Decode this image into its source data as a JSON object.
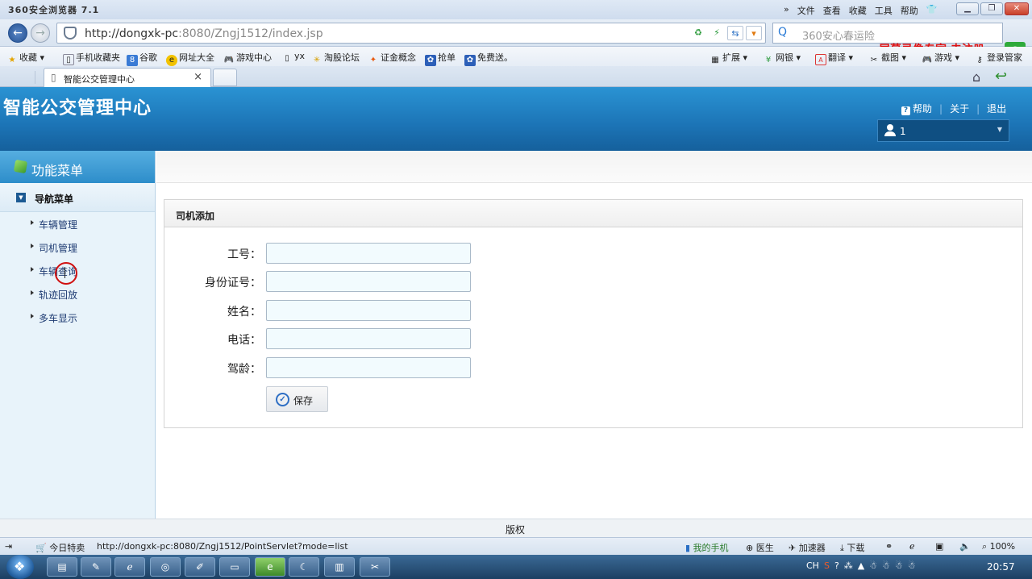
{
  "browser": {
    "title": "360安全浏览器 7.1",
    "menus": [
      "»",
      "文件",
      "查看",
      "收藏",
      "工具",
      "帮助"
    ],
    "url_host": "http://dongxk-pc",
    "url_path": ":8080/Zngj1512/index.jsp",
    "search_placeholder": "360安心春运险",
    "watermark": "屏幕录像专家  未注册",
    "bookmarks": [
      "收藏",
      "手机收藏夹",
      "谷歌",
      "网址大全",
      "游戏中心",
      "yx",
      "淘股论坛",
      "证金概念",
      "抢单",
      "免费送。"
    ],
    "toolbar_right": [
      "扩展",
      "网银",
      "翻译",
      "截图",
      "游戏",
      "登录管家"
    ],
    "tab_title": "智能公交管理中心",
    "tab_close": "×"
  },
  "app": {
    "title": "智能公交管理中心",
    "links": {
      "help": "帮助",
      "about": "关于",
      "logout": "退出"
    },
    "user": "1"
  },
  "sidebar": {
    "header": "功能菜单",
    "group": "导航菜单",
    "items": [
      "车辆管理",
      "司机管理",
      "车辆查询",
      "轨迹回放",
      "多车显示"
    ]
  },
  "panel": {
    "title": "司机添加",
    "fields": [
      {
        "label": "工号：",
        "value": ""
      },
      {
        "label": "身份证号：",
        "value": ""
      },
      {
        "label": "姓名：",
        "value": ""
      },
      {
        "label": "电话：",
        "value": ""
      },
      {
        "label": "驾龄：",
        "value": ""
      }
    ],
    "save": "保存"
  },
  "footer": {
    "copyright": "版权"
  },
  "status": {
    "today": "今日特卖",
    "link": "http://dongxk-pc:8080/Zngj1512/PointServlet?mode=list",
    "items": [
      "我的手机",
      "医生",
      "加速器",
      "下载"
    ],
    "zoom": "100%"
  },
  "taskbar": {
    "lang": "CH",
    "time": "20:57"
  }
}
